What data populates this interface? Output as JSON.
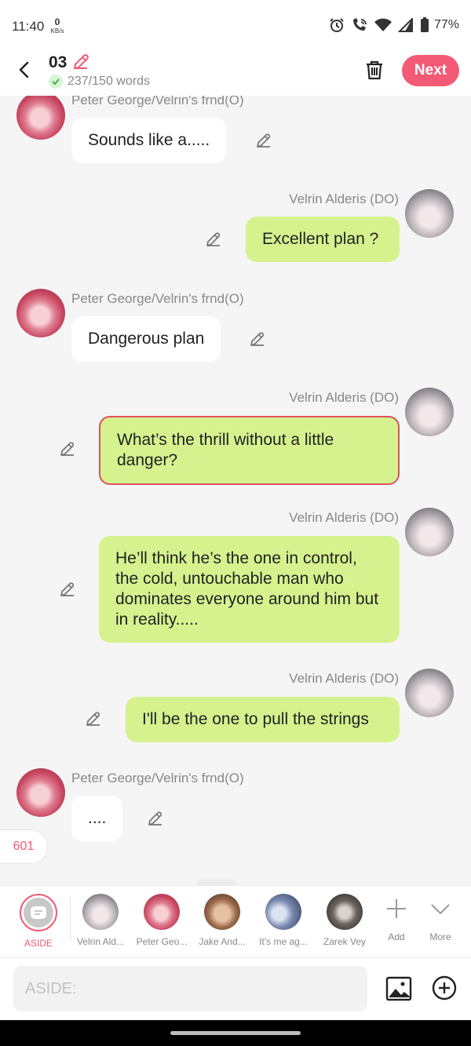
{
  "status": {
    "time": "11:40",
    "speed_value": "0",
    "speed_unit": "KB/s",
    "battery": "77%"
  },
  "header": {
    "title": "03",
    "word_count": "237/150 words",
    "next_label": "Next",
    "accent": "#f25a75"
  },
  "messages": [
    {
      "sender": "Peter George/Velrin's frnd(O)",
      "text": "Sounds like a.....",
      "side": "left"
    },
    {
      "sender": "Velrin Alderis (DO)",
      "text": "Excellent plan ?",
      "side": "right"
    },
    {
      "sender": "Peter George/Velrin's frnd(O)",
      "text": "Dangerous plan",
      "side": "left"
    },
    {
      "sender": "Velrin Alderis (DO)",
      "text": "What’s the thrill without a little danger?",
      "side": "right",
      "selected": true
    },
    {
      "sender": "Velrin Alderis (DO)",
      "text": "He’ll think he’s the one in control, the cold, untouchable man who dominates everyone around him but in reality.....",
      "side": "right"
    },
    {
      "sender": "Velrin Alderis (DO)",
      "text": "I'll be the one to pull the strings",
      "side": "right"
    },
    {
      "sender": "Peter George/Velrin's frnd(O)",
      "text": "....",
      "side": "left"
    }
  ],
  "count_badge": "601",
  "characters": [
    {
      "label": "ASIDE",
      "active": true
    },
    {
      "label": "Velrin Ald..."
    },
    {
      "label": "Peter Geo..."
    },
    {
      "label": "Jake And..."
    },
    {
      "label": "It's me ag..."
    },
    {
      "label": "Zarek Vey"
    },
    {
      "label": "Add",
      "icon": "plus-icon"
    },
    {
      "label": "More",
      "icon": "chevron-down-icon"
    }
  ],
  "input": {
    "placeholder": "ASIDE:",
    "value": ""
  }
}
